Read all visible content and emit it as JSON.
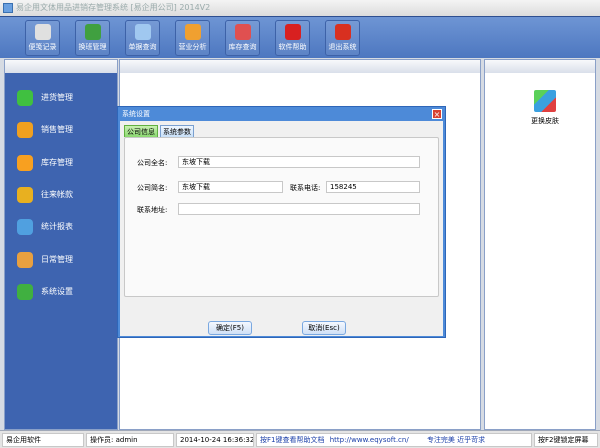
{
  "window": {
    "title": "易企用文体用品进销存管理系统 [易企用公司] 2014V2"
  },
  "toolbar": [
    {
      "label": "便笺记录",
      "icon": "notepad-icon",
      "color": "#e0e0e0"
    },
    {
      "label": "换班管理",
      "icon": "users-icon",
      "color": "#40a040"
    },
    {
      "label": "单据查询",
      "icon": "magnifier-icon",
      "color": "#a0c8f0"
    },
    {
      "label": "营业分析",
      "icon": "bar-chart-icon",
      "color": "#f0a030"
    },
    {
      "label": "库存查询",
      "icon": "house-icon",
      "color": "#e05050"
    },
    {
      "label": "软件帮助",
      "icon": "help-icon",
      "color": "#d82020"
    },
    {
      "label": "退出系统",
      "icon": "power-icon",
      "color": "#d83020"
    }
  ],
  "sidebar": [
    {
      "label": "进货管理",
      "icon": "plus-icon",
      "color": "#40c040"
    },
    {
      "label": "销售管理",
      "icon": "pie-chart-icon",
      "color": "#f0a020"
    },
    {
      "label": "库存管理",
      "icon": "star-icon",
      "color": "#f8a020"
    },
    {
      "label": "往来帐款",
      "icon": "dollar-icon",
      "color": "#e8b020"
    },
    {
      "label": "统计报表",
      "icon": "bar-chart-icon",
      "color": "#50a0e0"
    },
    {
      "label": "日常管理",
      "icon": "folder-icon",
      "color": "#e8a040"
    },
    {
      "label": "系统设置",
      "icon": "gear-icon",
      "color": "#40b040"
    }
  ],
  "right": {
    "skin_label": "更换皮肤"
  },
  "dialog": {
    "title": "系统设置",
    "tabs": [
      "公司信息",
      "系统参数"
    ],
    "full_name_label": "公司全名:",
    "full_name": "东坡下载",
    "short_name_label": "公司简名:",
    "short_name": "东坡下载",
    "phone_label": "联系电话:",
    "phone": "158245",
    "address_label": "联系地址:",
    "address": "",
    "ok": "确定(F5)",
    "cancel": "取消(Esc)"
  },
  "status": {
    "company": "易企用软件",
    "operator": "操作员: admin",
    "datetime": "2014-10-24 16:36:32",
    "help": "按F1键查看帮助文档",
    "url": "http://www.eqysoft.cn/",
    "slogan": "专注完美 近乎苛求",
    "lock": "按F2键锁定屏幕"
  }
}
